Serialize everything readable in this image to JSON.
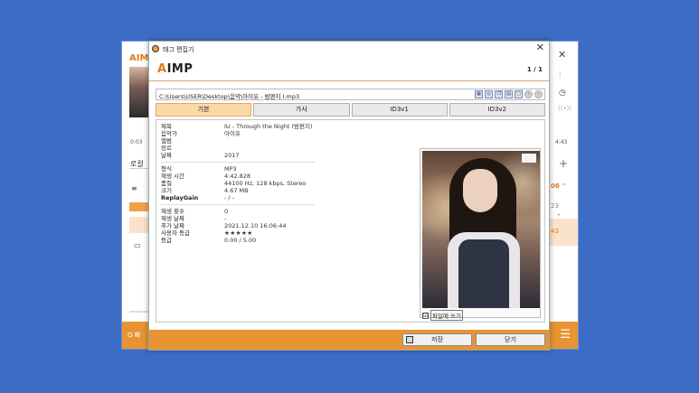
{
  "background_window": {
    "logo": "AIM",
    "time_left": "0:03",
    "time_right": "4:43",
    "left_text": "로컬",
    "right_num_1": "06 ⌃",
    "right_num_2": "23",
    "right_num_3": "43",
    "search_text": "Q 빠"
  },
  "dialog": {
    "title": "태그 편집기",
    "logo_a": "A",
    "logo_rest": "IMP",
    "page_count": "1 / 1",
    "path": "C:\\Users\\USER\\Desktop\\음악\\아이유 - 밤편지 I.mp3",
    "tabs": [
      "기본",
      "가사",
      "ID3v1",
      "ID3v2"
    ],
    "fields_group1": [
      {
        "label": "제목",
        "value": "IU - Through the Night (밤편지)"
      },
      {
        "label": "음악가",
        "value": "아이유"
      },
      {
        "label": "앨범",
        "value": ""
      },
      {
        "label": "장르",
        "value": ""
      },
      {
        "label": "날짜",
        "value": "2017"
      }
    ],
    "fields_group2": [
      {
        "label": "형식",
        "value": "MP3"
      },
      {
        "label": "재생 시간",
        "value": "4:42.828"
      },
      {
        "label": "품질",
        "value": "44100 Hz, 128 kbps, Stereo"
      },
      {
        "label": "크기",
        "value": "4.67 MB"
      },
      {
        "label": "ReplayGain",
        "value": "- / -"
      }
    ],
    "fields_group3": [
      {
        "label": "재생 횟수",
        "value": "0"
      },
      {
        "label": "재생 날짜",
        "value": "-"
      },
      {
        "label": "추가 날짜",
        "value": "2021.12.10 16:06:44"
      },
      {
        "label": "사용자 등급",
        "value": "★★★★★"
      },
      {
        "label": "등급",
        "value": "0.00 / 5.00"
      }
    ],
    "write_to_file": "파일에 쓰기",
    "write_checked": "☑",
    "save_label": "저장",
    "close_label": "닫기"
  }
}
